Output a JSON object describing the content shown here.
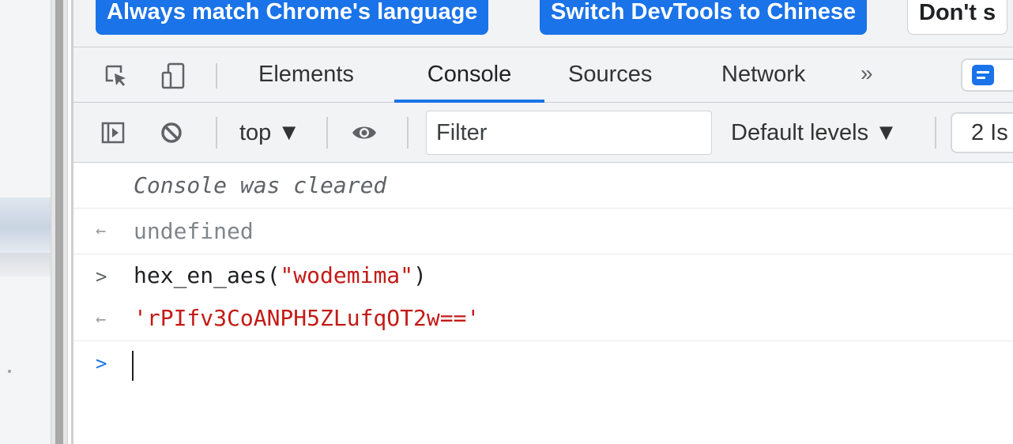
{
  "language_banner": {
    "match_chrome_label": "Always match Chrome's language",
    "switch_chinese_label": "Switch DevTools to Chinese",
    "dont_show_label": "Don't s"
  },
  "tabs": {
    "elements": "Elements",
    "console": "Console",
    "sources": "Sources",
    "network": "Network",
    "more": "»"
  },
  "console_toolbar": {
    "context": "top ▼",
    "filter_placeholder": "Filter",
    "levels": "Default levels ▼",
    "issues": "2 Is"
  },
  "console": {
    "cleared": "Console was cleared",
    "result_prefix": "←",
    "input_prefix": ">",
    "undefined_value": "undefined",
    "input_call_prefix": "hex_en_aes(",
    "input_argument": "\"wodemima\"",
    "input_call_suffix": ")",
    "result_value": "'rPIfv3CoANPH5ZLufqOT2w=='",
    "prompt_prefix": ">"
  },
  "colors": {
    "accent": "#1a73e8",
    "string": "#c41a16",
    "toolbar_bg": "#f1f3f4"
  },
  "icons": {
    "inspect": "inspect-element-icon",
    "device": "device-toolbar-icon",
    "sidebar": "console-sidebar-icon",
    "clear": "clear-console-icon",
    "eye": "live-expression-eye-icon",
    "messages": "messages-icon"
  }
}
